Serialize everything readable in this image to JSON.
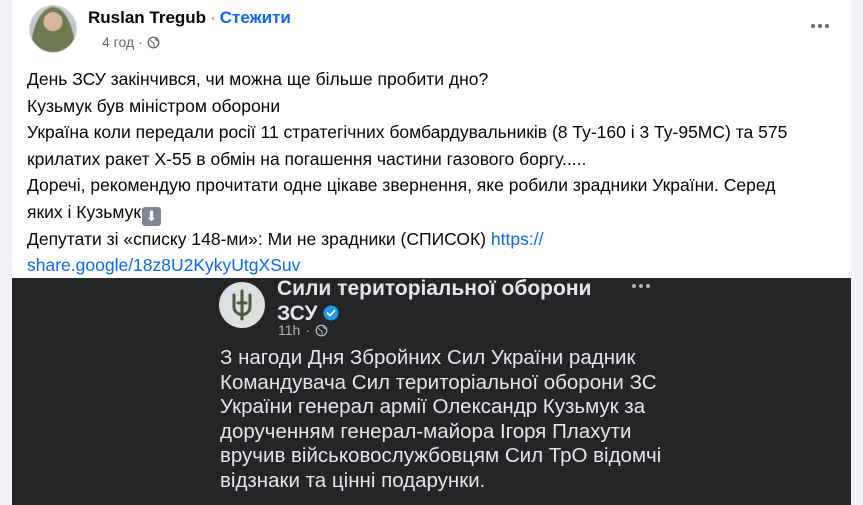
{
  "post": {
    "author": "Ruslan Tregub",
    "separator": "·",
    "follow_label": "Стежити",
    "time": "4 год",
    "audience_icon": "globe-icon",
    "more_icon": "more-options-icon",
    "text_lines": [
      "День ЗСУ закінчився, чи можна ще більше пробити дно?",
      "Кузьмук був міністром оборони",
      "Україна коли  передали росії 11 стратегічних бомбардувальників (8 Ту-160 і 3 Ту-95МС) та 575",
      "крилатих ракет Х-55 в обмін на погашення частини газового боргу.....",
      "Доречі, рекомендую прочитати одне цікаве звернення, яке робили зрадники України. Серед",
      "яких і Кузьмук"
    ],
    "emoji": "down-arrow-emoji",
    "deputies_line": "Депутати зі «списку 148-ми»: Ми не зрадники (СПИСОК) ",
    "link_part1": "https://",
    "link_part2": "share.google/18z8U2KykyUtgXSuv"
  },
  "shared": {
    "page_name_line1": "Сили територіальної оборони",
    "page_name_line2": "ЗСУ",
    "time": "11h",
    "text_lines": [
      "З нагоди Дня Збройних Сил України радник",
      "Командувача Сил територіальної оборони ЗС",
      "України генерал армії Олександр Кузьмук за",
      "дорученням генерал-майора Ігоря Плахути",
      "вручив військовослужбовцям Сил ТрО відомчі",
      "відзнаки та цінні подарунки."
    ]
  },
  "colors": {
    "accent": "#0866ff",
    "text": "#050505",
    "secondary": "#65676b",
    "dark_bg": "#242526",
    "dark_text": "#e4e6eb"
  }
}
